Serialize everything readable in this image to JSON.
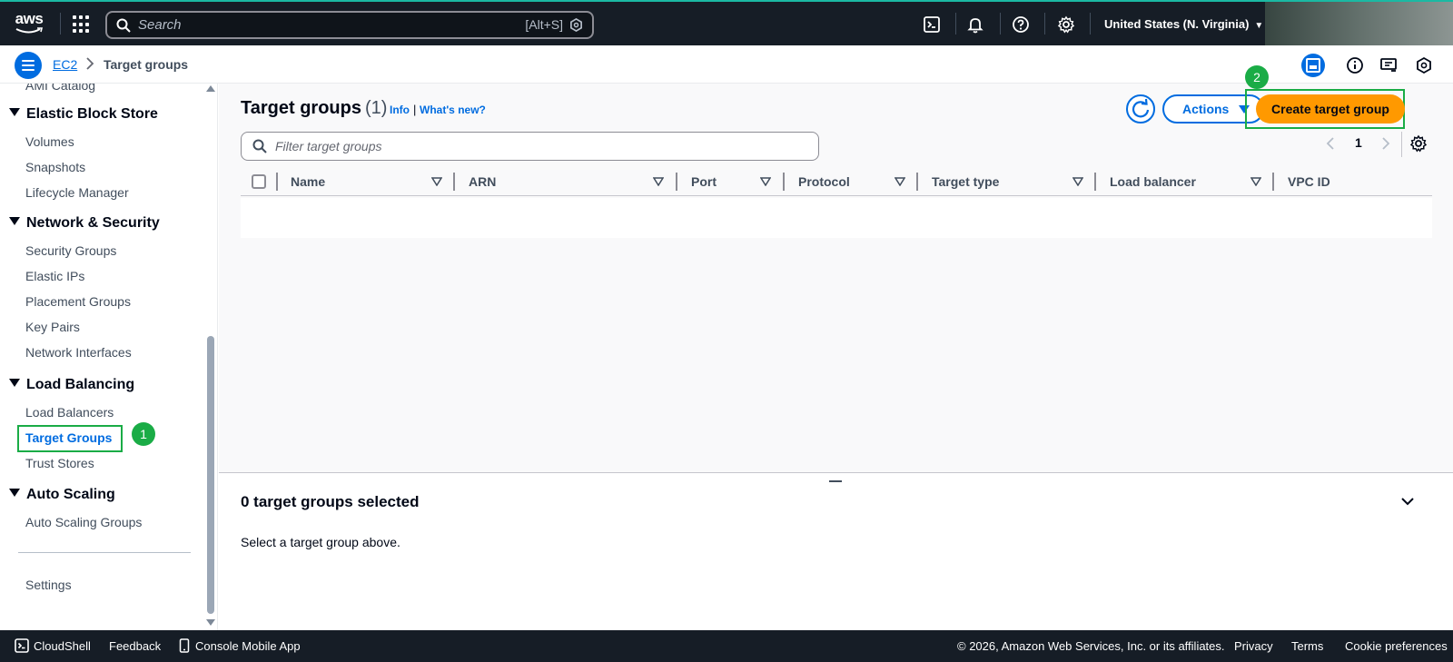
{
  "topbar": {
    "logo_text": "aws",
    "search_placeholder": "Search",
    "search_shortcut": "[Alt+S]",
    "region": "United States (N. Virginia)"
  },
  "breadcrumb": {
    "service": "EC2",
    "current": "Target groups"
  },
  "sidebar": {
    "partial_item": "AMI Catalog",
    "sections": [
      {
        "title": "Elastic Block Store",
        "items": [
          "Volumes",
          "Snapshots",
          "Lifecycle Manager"
        ]
      },
      {
        "title": "Network & Security",
        "items": [
          "Security Groups",
          "Elastic IPs",
          "Placement Groups",
          "Key Pairs",
          "Network Interfaces"
        ]
      },
      {
        "title": "Load Balancing",
        "items": [
          "Load Balancers",
          "Target Groups",
          "Trust Stores"
        ]
      },
      {
        "title": "Auto Scaling",
        "items": [
          "Auto Scaling Groups"
        ]
      }
    ],
    "settings": "Settings",
    "active_item": "Target Groups"
  },
  "annotations": {
    "step1": "1",
    "step2": "2"
  },
  "main": {
    "title": "Target groups",
    "count": "(1)",
    "info": "Info",
    "separator": "|",
    "whats_new": "What's new?",
    "actions_label": "Actions",
    "create_label": "Create target group",
    "filter_placeholder": "Filter target groups",
    "page_number": "1",
    "columns": [
      "Name",
      "ARN",
      "Port",
      "Protocol",
      "Target type",
      "Load balancer",
      "VPC ID"
    ]
  },
  "split_panel": {
    "title": "0 target groups selected",
    "message": "Select a target group above."
  },
  "footer": {
    "cloudshell": "CloudShell",
    "feedback": "Feedback",
    "mobile_app": "Console Mobile App",
    "copyright": "© 2026, Amazon Web Services, Inc. or its affiliates.",
    "privacy": "Privacy",
    "terms": "Terms",
    "cookies": "Cookie preferences"
  },
  "colors": {
    "accent": "#006ce0",
    "primary_button": "#ff9900",
    "highlight": "#1aac46",
    "topbar": "#161d26"
  }
}
